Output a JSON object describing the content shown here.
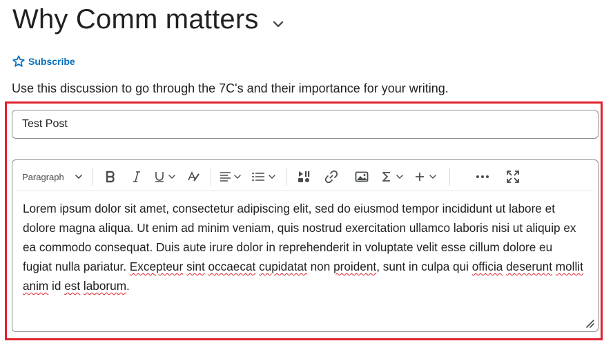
{
  "page": {
    "title": "Why Comm matters",
    "subscribe_label": "Subscribe",
    "description": "Use this discussion to go through the 7C's and their importance for your writing."
  },
  "post": {
    "subject_value": "Test Post"
  },
  "toolbar": {
    "format_label": "Paragraph",
    "icons": [
      "bold-icon",
      "italic-icon",
      "underline-icon",
      "clear-format-icon",
      "align-icon",
      "list-icon",
      "insert-media-icon",
      "link-icon",
      "image-icon",
      "equation-icon",
      "insert-more-icon",
      "more-options-icon",
      "fullscreen-icon"
    ]
  },
  "editor": {
    "body_parts": [
      "Lorem ipsum dolor sit amet, consectetur adipiscing elit, sed do eiusmod tempor incididunt ut labore et dolore magna aliqua. Ut enim ad minim veniam, quis nostrud exercitation ullamco laboris nisi ut aliquip ex ea commodo consequat. Duis aute irure dolor in reprehenderit in voluptate velit esse cillum dolore eu fugiat nulla pariatur. ",
      "Excepteur",
      " ",
      "sint",
      " ",
      "occaecat",
      " ",
      "cupidatat",
      " non ",
      "proident",
      ", sunt in culpa qui ",
      "officia",
      " ",
      "deserunt",
      " ",
      "mollit",
      " ",
      "anim",
      " id ",
      "est",
      " ",
      "laborum",
      "."
    ]
  },
  "colors": {
    "accent": "#006fbf",
    "highlight": "#e0202c",
    "text": "#202122"
  }
}
